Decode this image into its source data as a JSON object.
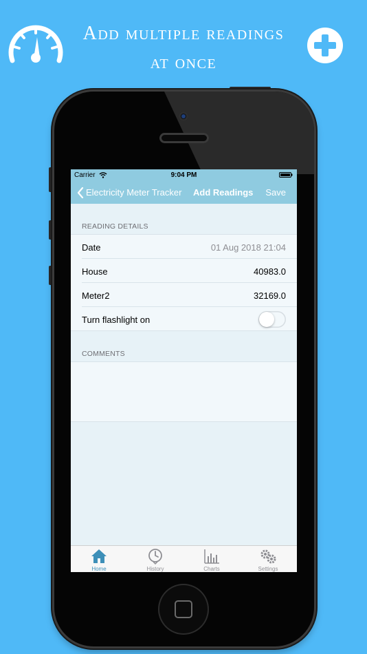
{
  "promo": {
    "title_line1": "Add multiple readings",
    "title_line2": "at once",
    "left_icon": "gauge-icon",
    "right_icon": "plus-circle-icon"
  },
  "status_bar": {
    "carrier": "Carrier",
    "time": "9:04 PM"
  },
  "nav": {
    "back_label": "Electricity Meter Tracker",
    "title": "Add Readings",
    "save_label": "Save"
  },
  "reading_details": {
    "header": "READING DETAILS",
    "rows": [
      {
        "label": "Date",
        "value": "01 Aug 2018 21:04"
      },
      {
        "label": "House",
        "value": "40983.0"
      },
      {
        "label": "Meter2",
        "value": "32169.0"
      }
    ],
    "flashlight_label": "Turn flashlight on",
    "flashlight_on": false
  },
  "comments": {
    "header": "COMMENTS",
    "value": ""
  },
  "tabs": [
    {
      "label": "Home",
      "icon": "home-icon",
      "active": true
    },
    {
      "label": "History",
      "icon": "history-icon",
      "active": false
    },
    {
      "label": "Charts",
      "icon": "chart-icon",
      "active": false
    },
    {
      "label": "Settings",
      "icon": "gear-icon",
      "active": false
    }
  ],
  "colors": {
    "background": "#4fb9f7",
    "nav_bar": "#8fcbe0",
    "active_tab": "#3d8fb8"
  }
}
